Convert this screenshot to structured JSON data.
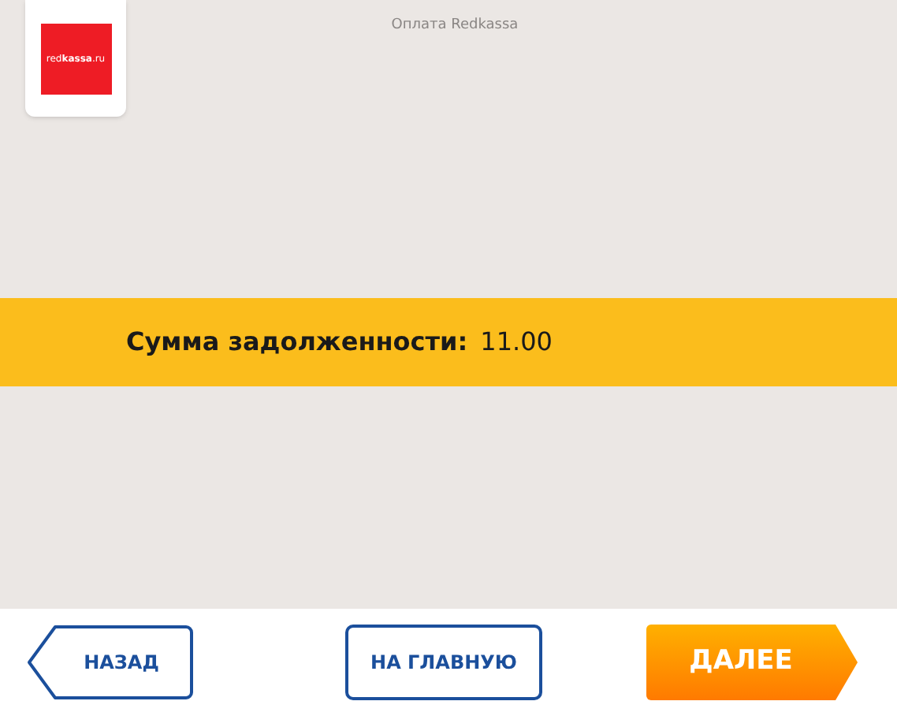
{
  "header": {
    "logo_text": "red**kassa**.ru",
    "title": "Оплата Redkassa"
  },
  "debt": {
    "label": "Сумма задолженности:",
    "value": "11.00"
  },
  "buttons": [
    {
      "kind": "back",
      "label": "НАЗАД"
    },
    {
      "kind": "home",
      "label": "НА ГЛАВНУЮ"
    },
    {
      "kind": "next",
      "label": "ДАЛЕЕ"
    }
  ]
}
